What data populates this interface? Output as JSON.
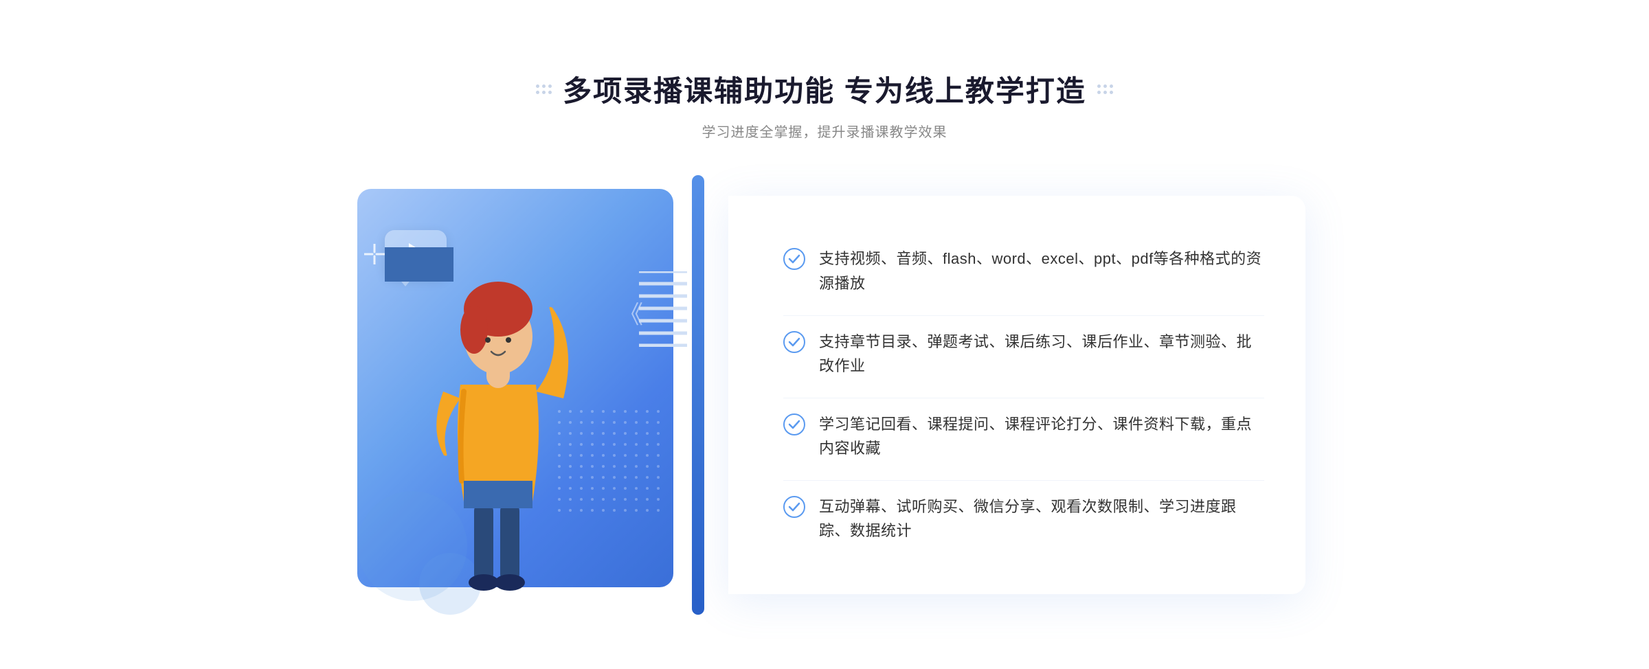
{
  "header": {
    "title": "多项录播课辅助功能 专为线上教学打造",
    "subtitle": "学习进度全掌握，提升录播课教学效果"
  },
  "features": [
    {
      "id": 1,
      "text": "支持视频、音频、flash、word、excel、ppt、pdf等各种格式的资源播放"
    },
    {
      "id": 2,
      "text": "支持章节目录、弹题考试、课后练习、课后作业、章节测验、批改作业"
    },
    {
      "id": 3,
      "text": "学习笔记回看、课程提问、课程评论打分、课件资料下载，重点内容收藏"
    },
    {
      "id": 4,
      "text": "互动弹幕、试听购买、微信分享、观看次数限制、学习进度跟踪、数据统计"
    }
  ],
  "colors": {
    "accent_blue": "#4a7fe8",
    "light_blue": "#a8c8f8",
    "text_dark": "#1a1a2e",
    "text_gray": "#888888",
    "text_body": "#333333"
  },
  "icons": {
    "check": "✓",
    "play": "▶",
    "chevron_left": "《",
    "chevron_right": "»"
  }
}
